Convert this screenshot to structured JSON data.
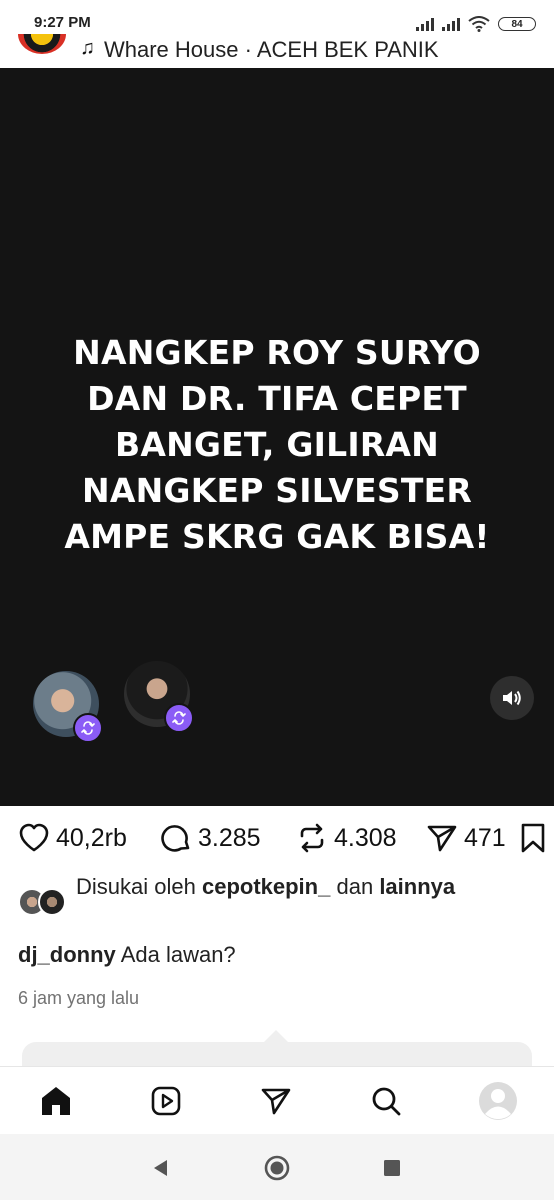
{
  "status_bar": {
    "time": "9:27 PM",
    "battery": "84"
  },
  "post_header": {
    "music_icon": "music-note-icon",
    "audio_title": "Whare House · ACEH BEK PANIK"
  },
  "media": {
    "overlay_text": "NANGKEP ROY SURYO DAN DR. TIFA CEPET BANGET, GILIRAN NANGKEP SILVESTER AMPE SKRG GAK BISA!",
    "background_color": "#141414"
  },
  "actions": {
    "likes": "40,2rb",
    "comments": "3.285",
    "reposts": "4.308",
    "shares": "471"
  },
  "liked_by": {
    "prefix": "Disukai oleh",
    "user": "cepotkepin_",
    "connector": "dan",
    "others": "lainnya"
  },
  "caption": {
    "username": "dj_donny",
    "text": "Ada lawan?"
  },
  "timestamp": "6 jam yang lalu",
  "colors": {
    "repost_badge": "#8b5cf6",
    "timestamp_gray": "#737373"
  },
  "bottom_nav": [
    "home-icon",
    "reels-icon",
    "direct-icon",
    "search-icon",
    "profile-avatar"
  ]
}
